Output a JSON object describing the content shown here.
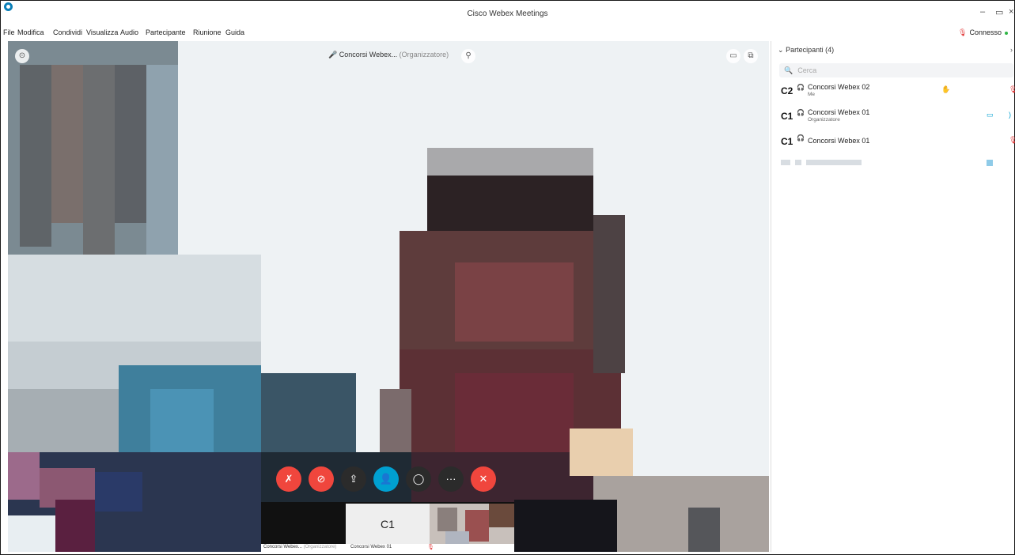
{
  "window": {
    "title": "Cisco Webex Meetings",
    "minimize_label": "–",
    "restore_label": "▭",
    "close_label": "×"
  },
  "menubar": {
    "items": [
      "File",
      "Modifica",
      "Condividi",
      "Visualizza",
      "Audio",
      "Partecipante",
      "Riunione",
      "Guida"
    ],
    "status": "Connesso"
  },
  "video": {
    "speaker_name": "Concorsi Webex...",
    "speaker_role": "(Organizzatore)",
    "info_icon": "info-icon",
    "layout_icon": "layout-icon",
    "popout_icon": "popout-icon"
  },
  "controls": [
    {
      "name": "mute-button",
      "icon": "mic-off-icon",
      "color": "#f0463d"
    },
    {
      "name": "stop-video-button",
      "icon": "camera-off-icon",
      "color": "#f0463d"
    },
    {
      "name": "share-button",
      "icon": "share-icon",
      "color": "#2b2b2b"
    },
    {
      "name": "participants-button",
      "icon": "participants-icon",
      "color": "#00a0d1"
    },
    {
      "name": "chat-button",
      "icon": "chat-icon",
      "color": "#2b2b2b"
    },
    {
      "name": "more-button",
      "icon": "more-icon",
      "color": "#2b2b2b"
    },
    {
      "name": "leave-button",
      "icon": "close-icon",
      "color": "#f0463d"
    }
  ],
  "thumbnails": {
    "self_initials": "C1",
    "label_organizer": "Concorsi Webex...",
    "label_organizer_role": "(Organizzatore)",
    "label_self": "Concorsi Webex 01"
  },
  "panel": {
    "title": "Partecipanti (4)",
    "search_placeholder": "Cerca",
    "participants": [
      {
        "initials": "C2",
        "name": "Concorsi Webex 02",
        "role": "Me"
      },
      {
        "initials": "C1",
        "name": "Concorsi Webex 01",
        "role": "Organizzatore"
      },
      {
        "initials": "C1",
        "name": "Concorsi Webex 01",
        "role": ""
      }
    ]
  },
  "colors": {
    "accent": "#00a0d1",
    "danger": "#f0463d",
    "ok": "#2fb545"
  }
}
